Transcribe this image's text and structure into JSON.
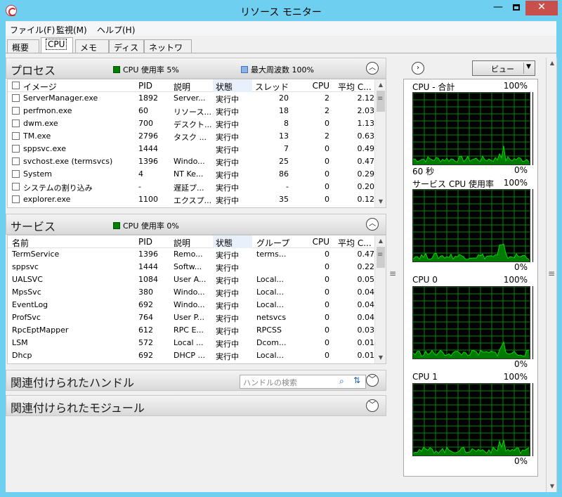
{
  "window": {
    "title": "リソース モニター",
    "close": "✕",
    "minimize": "—"
  },
  "menu": [
    "ファイル(F)",
    "監視(M)",
    "ヘルプ(H)"
  ],
  "tabs": [
    "概要",
    "CPU",
    "メモリ",
    "ディスク",
    "ネットワーク"
  ],
  "processes": {
    "title": "プロセス",
    "cpu_usage": "CPU 使用率 5%",
    "max_freq": "最大周波数 100%",
    "columns": [
      "イメージ",
      "PID",
      "説明",
      "状態",
      "スレッド",
      "CPU",
      "平均 C..."
    ],
    "rows": [
      [
        "ServerManager.exe",
        "1892",
        "Server...",
        "実行中",
        "20",
        "2",
        "2.12"
      ],
      [
        "perfmon.exe",
        "60",
        "リソース...",
        "実行中",
        "18",
        "2",
        "2.03"
      ],
      [
        "dwm.exe",
        "700",
        "デスクト...",
        "実行中",
        "8",
        "0",
        "1.13"
      ],
      [
        "TM.exe",
        "2796",
        "タスク ...",
        "実行中",
        "13",
        "2",
        "0.63"
      ],
      [
        "sppsvc.exe",
        "1444",
        "",
        "実行中",
        "7",
        "0",
        "0.49"
      ],
      [
        "svchost.exe (termsvcs)",
        "1396",
        "Windo...",
        "実行中",
        "25",
        "0",
        "0.47"
      ],
      [
        "System",
        "4",
        "NT Ke...",
        "実行中",
        "86",
        "0",
        "0.29"
      ],
      [
        "システムの割り込み",
        "-",
        "遅延プ...",
        "実行中",
        "-",
        "0",
        "0.20"
      ],
      [
        "explorer.exe",
        "1100",
        "エクスプ...",
        "実行中",
        "35",
        "0",
        "0.12"
      ]
    ]
  },
  "services": {
    "title": "サービス",
    "cpu_usage": "CPU 使用率 0%",
    "columns": [
      "名前",
      "PID",
      "説明",
      "状態",
      "グループ",
      "CPU",
      "平均 C..."
    ],
    "rows": [
      [
        "TermService",
        "1396",
        "Remo...",
        "実行中",
        "terms...",
        "0",
        "0.47"
      ],
      [
        "sppsvc",
        "1444",
        "Softw...",
        "実行中",
        "",
        "0",
        "0.22"
      ],
      [
        "UALSVC",
        "1084",
        "User A...",
        "実行中",
        "Local...",
        "0",
        "0.05"
      ],
      [
        "MpsSvc",
        "380",
        "Windo...",
        "実行中",
        "Local...",
        "0",
        "0.04"
      ],
      [
        "EventLog",
        "692",
        "Windo...",
        "実行中",
        "Local...",
        "0",
        "0.04"
      ],
      [
        "ProfSvc",
        "764",
        "User P...",
        "実行中",
        "netsvcs",
        "0",
        "0.04"
      ],
      [
        "RpcEptMapper",
        "612",
        "RPC E...",
        "実行中",
        "RPCSS",
        "0",
        "0.03"
      ],
      [
        "LSM",
        "572",
        "Local ...",
        "実行中",
        "Dcom...",
        "0",
        "0.01"
      ],
      [
        "Dhcp",
        "692",
        "DHCP ...",
        "実行中",
        "Local...",
        "0",
        "0.01"
      ]
    ]
  },
  "handles": {
    "title": "関連付けられたハンドル",
    "search_placeholder": "ハンドルの検索"
  },
  "modules": {
    "title": "関連付けられたモジュール"
  },
  "right": {
    "view_label": "ビュー",
    "graphs": [
      {
        "title": "CPU - 合計",
        "max": "100%",
        "min": "0%",
        "time": "60 秒"
      },
      {
        "title": "サービス CPU 使用率",
        "max": "100%",
        "min": "0%"
      },
      {
        "title": "CPU 0",
        "max": "100%",
        "min": "0%"
      },
      {
        "title": "CPU 1",
        "max": "100%",
        "min": "0%"
      }
    ]
  },
  "colors": {
    "graph_line": "#00d800",
    "graph_fill": "#007a00",
    "graph_grid": "#008c00"
  }
}
